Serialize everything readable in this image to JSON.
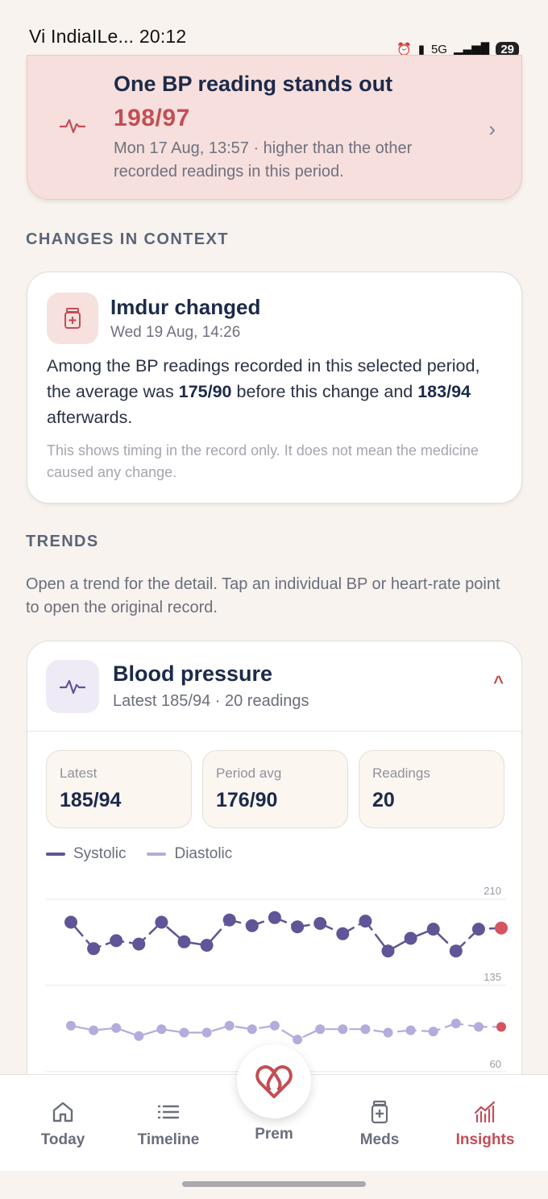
{
  "status_bar": {
    "carrier_time": "Vi IndiaILe... 20:12",
    "network": "5G",
    "battery": "29"
  },
  "alert": {
    "title": "One BP reading stands out",
    "value": "198/97",
    "detail": "Mon 17 Aug, 13:57 · higher than the other recorded readings in this period."
  },
  "context": {
    "section_label": "CHANGES IN CONTEXT",
    "title": "Imdur changed",
    "date": "Wed 19 Aug, 14:26",
    "body_pre": "Among the BP readings recorded in this selected period, the average was ",
    "before_value": "175/90",
    "body_mid": " before this change and ",
    "after_value": "183/94",
    "body_post": " afterwards.",
    "note": "This shows timing in the record only. It does not mean the medicine caused any change."
  },
  "trends": {
    "section_label": "TRENDS",
    "description": "Open a trend for the detail. Tap an individual BP or heart-rate point to open the original record."
  },
  "bp_card": {
    "title": "Blood pressure",
    "subtitle": "Latest 185/94 · 20 readings",
    "toggle": "^",
    "stats": [
      {
        "label": "Latest",
        "value": "185/94"
      },
      {
        "label": "Period avg",
        "value": "176/90"
      },
      {
        "label": "Readings",
        "value": "20"
      }
    ]
  },
  "chart_data": {
    "type": "line",
    "legend": [
      "Systolic",
      "Diastolic"
    ],
    "axis_labels": [
      "210",
      "135",
      "60"
    ],
    "colors": {
      "systolic": "#5f5597",
      "diastolic": "#b3acdd",
      "latest": "#d5545f"
    },
    "series": [
      {
        "name": "Systolic",
        "ylim": [
          135,
          210
        ],
        "values": [
          190,
          167,
          174,
          171,
          190,
          173,
          170,
          192,
          187,
          194,
          186,
          189,
          180,
          191,
          165,
          176,
          184,
          165,
          184,
          185
        ]
      },
      {
        "name": "Diastolic",
        "ylim": [
          60,
          135
        ],
        "values": [
          100,
          96,
          98,
          91,
          97,
          94,
          94,
          100,
          97,
          100,
          88,
          97,
          97,
          97,
          94,
          96,
          95,
          102,
          99,
          99
        ]
      }
    ]
  },
  "nav": {
    "items": [
      {
        "label": "Today",
        "icon": "home-icon"
      },
      {
        "label": "Timeline",
        "icon": "list-icon"
      },
      {
        "label": "Prem",
        "icon": "heart-logo-icon"
      },
      {
        "label": "Meds",
        "icon": "medicine-icon"
      },
      {
        "label": "Insights",
        "icon": "insights-chart-icon"
      }
    ],
    "active_color": "#c24e55"
  }
}
